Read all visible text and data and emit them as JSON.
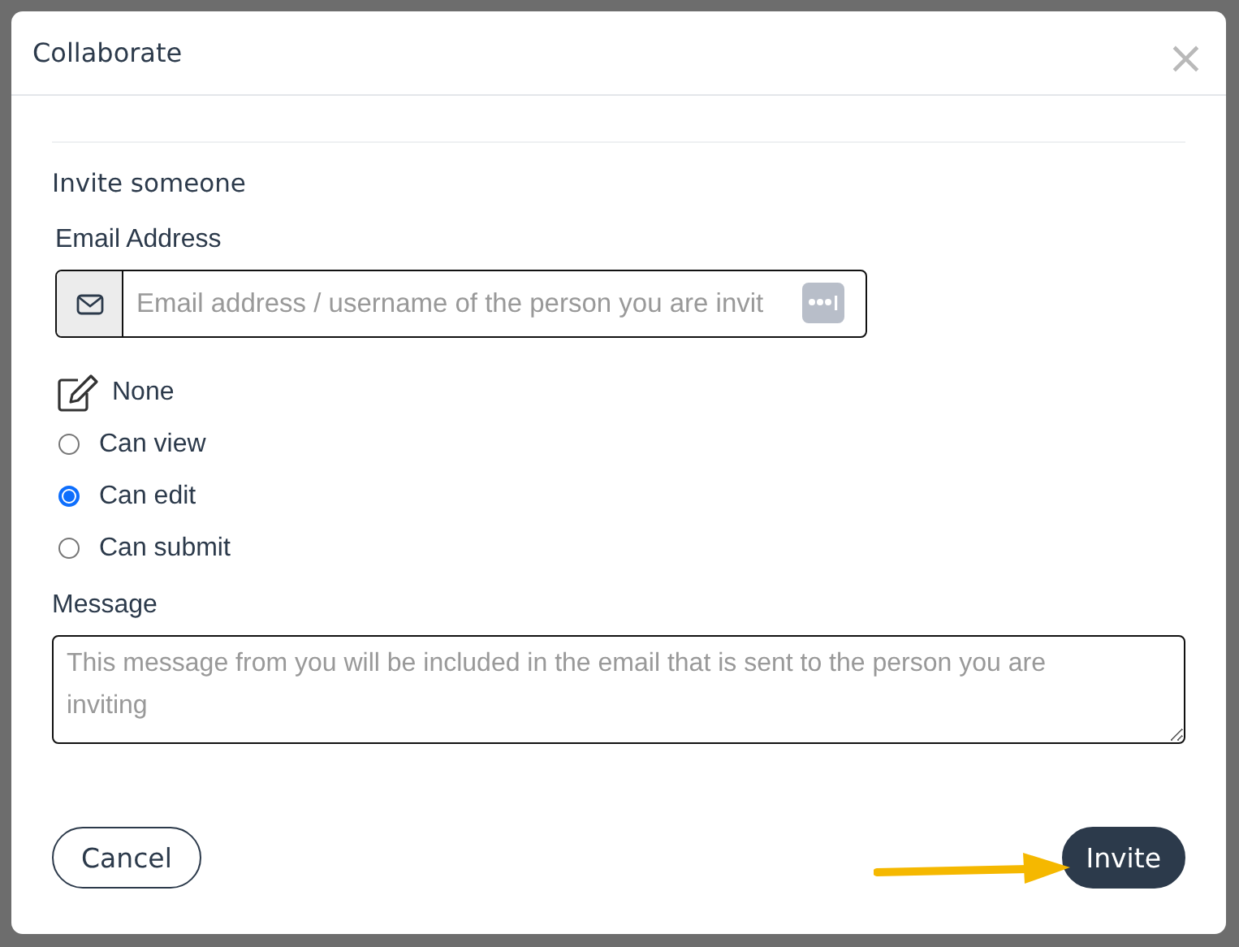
{
  "dialog": {
    "title": "Collaborate",
    "close": "×"
  },
  "invite": {
    "heading": "Invite someone",
    "email_label": "Email Address",
    "email_placeholder": "Email address / username of the person you are invit",
    "options": [
      {
        "kind": "icon",
        "label": "None",
        "selected": false
      },
      {
        "kind": "radio",
        "label": "Can view",
        "selected": false
      },
      {
        "kind": "radio",
        "label": "Can edit",
        "selected": true
      },
      {
        "kind": "radio",
        "label": "Can submit",
        "selected": false
      }
    ],
    "message_label": "Message",
    "message_placeholder": "This message from you will be included in the email that is sent to the person you are inviting"
  },
  "buttons": [
    {
      "kind": "outline",
      "label": "Cancel"
    },
    {
      "kind": "primary",
      "label": "Invite"
    }
  ]
}
